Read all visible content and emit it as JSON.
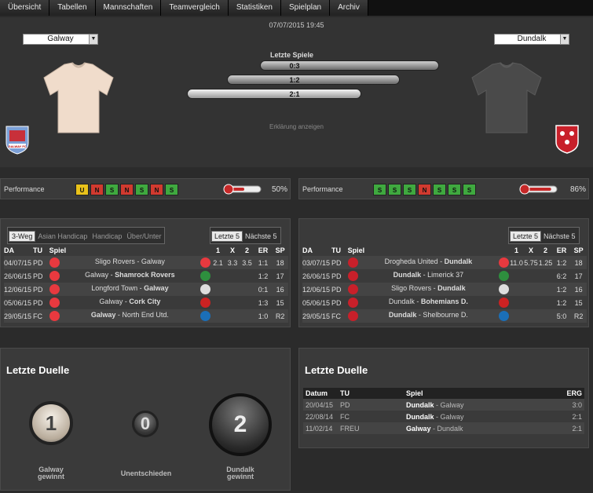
{
  "nav": {
    "tabs": [
      "Übersicht",
      "Tabellen",
      "Mannschaften",
      "Teamvergleich",
      "Statistiken",
      "Spielplan",
      "Archiv"
    ]
  },
  "header": {
    "datetime": "07/07/2015 19:45",
    "home_select": "Galway",
    "away_select": "Dundalk",
    "last_games_label": "Letzte Spiele",
    "bars": [
      {
        "value": "0:3"
      },
      {
        "value": "1:2"
      },
      {
        "value": "2:1"
      }
    ],
    "explain_link": "Erklärung anzeigen",
    "home_crest_text": "GALWAY FC"
  },
  "performance": {
    "label": "Performance",
    "home": {
      "badges": [
        "U",
        "N",
        "S",
        "N",
        "S",
        "N",
        "S"
      ],
      "percent": "50%",
      "level": 0.5
    },
    "away": {
      "badges": [
        "S",
        "S",
        "S",
        "N",
        "S",
        "S",
        "S"
      ],
      "percent": "86%",
      "level": 0.86
    }
  },
  "home_form": {
    "tabs": [
      "3-Weg",
      "Asian Handicap",
      "Handicap",
      "Über/Unter"
    ],
    "toggle": [
      "Letzte 5",
      "Nächste 5"
    ],
    "headers": [
      "DA",
      "TU",
      "Spiel",
      "1",
      "X",
      "2",
      "ER",
      "SP"
    ],
    "rows": [
      {
        "date": "04/07/15",
        "tu": "PD",
        "home": "Sligo Rovers",
        "away": "Galway",
        "bold": "",
        "o1": "2.1",
        "ox": "3.3",
        "o2": "3.5",
        "er": "1:1",
        "sp": "18"
      },
      {
        "date": "26/06/15",
        "tu": "PD",
        "home": "Galway",
        "away": "Shamrock Rovers",
        "bold": "away",
        "o1": "",
        "ox": "",
        "o2": "",
        "er": "1:2",
        "sp": "17"
      },
      {
        "date": "12/06/15",
        "tu": "PD",
        "home": "Longford Town",
        "away": "Galway",
        "bold": "away",
        "o1": "",
        "ox": "",
        "o2": "",
        "er": "0:1",
        "sp": "16"
      },
      {
        "date": "05/06/15",
        "tu": "PD",
        "home": "Galway",
        "away": "Cork City",
        "bold": "away",
        "o1": "",
        "ox": "",
        "o2": "",
        "er": "1:3",
        "sp": "15"
      },
      {
        "date": "29/05/15",
        "tu": "FC",
        "home": "Galway",
        "away": "North End Utd.",
        "bold": "home",
        "o1": "",
        "ox": "",
        "o2": "",
        "er": "1:0",
        "sp": "R2"
      }
    ]
  },
  "away_form": {
    "toggle": [
      "Letzte 5",
      "Nächste 5"
    ],
    "headers": [
      "DA",
      "TU",
      "Spiel",
      "1",
      "X",
      "2",
      "ER",
      "SP"
    ],
    "rows": [
      {
        "date": "03/07/15",
        "tu": "PD",
        "home": "Drogheda United",
        "away": "Dundalk",
        "bold": "away",
        "o1": "11.0",
        "ox": "5.75",
        "o2": "1.25",
        "er": "1:2",
        "sp": "18"
      },
      {
        "date": "26/06/15",
        "tu": "PD",
        "home": "Dundalk",
        "away": "Limerick 37",
        "bold": "home",
        "o1": "",
        "ox": "",
        "o2": "",
        "er": "6:2",
        "sp": "17"
      },
      {
        "date": "12/06/15",
        "tu": "PD",
        "home": "Sligo Rovers",
        "away": "Dundalk",
        "bold": "away",
        "o1": "",
        "ox": "",
        "o2": "",
        "er": "1:2",
        "sp": "16"
      },
      {
        "date": "05/06/15",
        "tu": "PD",
        "home": "Dundalk",
        "away": "Bohemians D.",
        "bold": "away",
        "o1": "",
        "ox": "",
        "o2": "",
        "er": "1:2",
        "sp": "15"
      },
      {
        "date": "29/05/15",
        "tu": "FC",
        "home": "Dundalk",
        "away": "Shelbourne D.",
        "bold": "home",
        "o1": "",
        "ox": "",
        "o2": "",
        "er": "5:0",
        "sp": "R2"
      }
    ]
  },
  "duels_left": {
    "title": "Letzte Duelle",
    "home_wins": "1",
    "draws": "0",
    "away_wins": "2",
    "home_label_1": "Galway",
    "home_label_2": "gewinnt",
    "draw_label": "Unentschieden",
    "away_label_1": "Dundalk",
    "away_label_2": "gewinnt"
  },
  "duels_right": {
    "title": "Letzte Duelle",
    "headers": [
      "Datum",
      "TU",
      "Spiel",
      "ERG"
    ],
    "rows": [
      {
        "date": "20/04/15",
        "tu": "PD",
        "home": "Dundalk",
        "away": "Galway",
        "bold": "home",
        "erg": "3:0"
      },
      {
        "date": "22/08/14",
        "tu": "FC",
        "home": "Dundalk",
        "away": "Galway",
        "bold": "home",
        "erg": "2:1"
      },
      {
        "date": "11/02/14",
        "tu": "FREU",
        "home": "Galway",
        "away": "Dundalk",
        "bold": "home",
        "erg": "2:1"
      }
    ]
  },
  "colors": {
    "win": "#3fa93f",
    "loss": "#d13a2f",
    "draw": "#e9c21a",
    "home_shirt": "#f0dccb",
    "away_shirt": "#4a4a4a"
  }
}
